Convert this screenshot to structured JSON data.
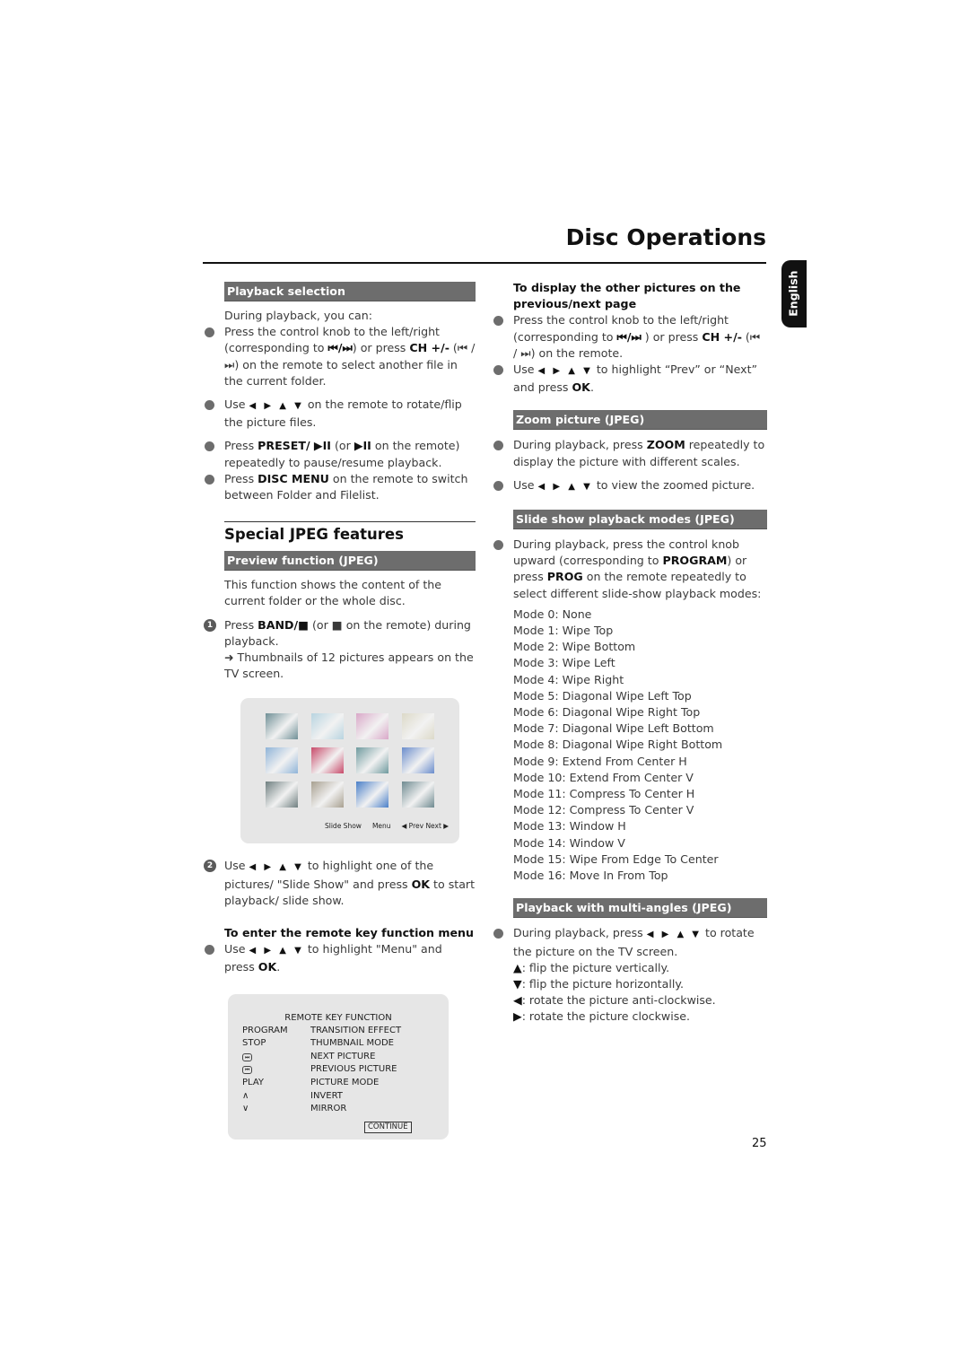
{
  "header": {
    "title": "Disc Operations",
    "language_tab": "English"
  },
  "left": {
    "playback_selection": {
      "heading": "Playback selection",
      "intro": "During playback, you can:",
      "items": [
        {
          "pre": "Press the control knob to the left/right (corresponding to ",
          "sym": "⏮/⏭",
          "mid": ") or press ",
          "bold": "CH +/-",
          "post": " (⏮ / ⏭) on the remote to select another file in the current folder."
        },
        {
          "pre": "Use ",
          "sym": "◀ ▶ ▲ ▼",
          "post": " on the remote to rotate/flip the picture files."
        },
        {
          "pre": "Press ",
          "bold": "PRESET/ ▶II",
          "mid": " (or ",
          "sym": "▶II",
          "post": " on the remote) repeatedly to pause/resume playback."
        },
        {
          "pre": "Press ",
          "bold": "DISC MENU",
          "post": " on the remote to switch between Folder and Filelist."
        }
      ]
    },
    "special": {
      "heading": "Special JPEG features",
      "preview_heading": "Preview function (JPEG)",
      "preview_intro": "This function shows the content of the current folder or the whole disc.",
      "step1": {
        "num": "1",
        "pre": "Press ",
        "bold": "BAND/■",
        "post": " (or ■ on the remote) during playback.",
        "result": "➜ Thumbnails of 12 pictures appears on the TV screen."
      },
      "thumbnail_screen": {
        "thumbnail_count": 12,
        "thumb_colors": [
          "#6f8f96",
          "#b8d4e0",
          "#d9a8c8",
          "#dcd9c8",
          "#8fb4d8",
          "#c84a6a",
          "#6f9a9e",
          "#6a8ccc",
          "#6f7f80",
          "#a8a090",
          "#4a7fc8",
          "#6f8a90"
        ],
        "nav": {
          "slide_show": "Slide Show",
          "menu": "Menu",
          "prev": "◀ Prev",
          "next": "Next ▶"
        }
      },
      "step2": {
        "num": "2",
        "pre": "Use ",
        "sym": "◀ ▶ ▲ ▼",
        "mid": " to highlight one of the pictures/ \"Slide Show\" and press ",
        "bold": "OK",
        "post": " to start playback/ slide show."
      },
      "remote_menu_heading": "To enter the remote key function menu",
      "remote_menu_item": {
        "pre": "Use ",
        "sym": "◀ ▶ ▲ ▼",
        "mid": " to highlight \"Menu\" and press ",
        "bold": "OK",
        "post": "."
      },
      "remote_screen": {
        "title": "REMOTE KEY FUNCTION",
        "rows": [
          {
            "key": "PROGRAM",
            "function": "TRANSITION EFFECT"
          },
          {
            "key": "STOP",
            "function": "THUMBNAIL MODE"
          },
          {
            "key": "⏭",
            "function": "NEXT PICTURE"
          },
          {
            "key": "⏮",
            "function": "PREVIOUS PICTURE"
          },
          {
            "key": "PLAY",
            "function": "PICTURE MODE"
          },
          {
            "key": "∧",
            "function": "INVERT"
          },
          {
            "key": "∨",
            "function": "MIRROR"
          }
        ],
        "continue_label": "CONTINUE"
      }
    }
  },
  "right": {
    "other_pictures": {
      "heading": "To display the other pictures on the previous/next page",
      "items": [
        {
          "pre": "Press the control knob to the left/right (corresponding to ",
          "sym": "⏮/⏭",
          "mid": " ) or press ",
          "bold": "CH +/-",
          "post": " (⏮ / ⏭) on the remote."
        },
        {
          "pre": "Use ",
          "sym": "◀ ▶ ▲ ▼",
          "mid": " to highlight “Prev” or “Next” and press ",
          "bold": "OK",
          "post": "."
        }
      ]
    },
    "zoom": {
      "heading": "Zoom picture (JPEG)",
      "items": [
        {
          "pre": "During playback, press ",
          "bold": "ZOOM",
          "post": " repeatedly to display the picture with different scales."
        },
        {
          "pre": "Use ",
          "sym": "◀ ▶ ▲ ▼",
          "post": " to view the zoomed picture."
        }
      ]
    },
    "slideshow": {
      "heading": "Slide show playback modes (JPEG)",
      "item": {
        "pre": "During playback, press the control knob upward (corresponding to ",
        "bold": "PROGRAM",
        "mid": ") or press ",
        "bold2": "PROG",
        "post": " on the remote repeatedly to select different slide-show playback modes:"
      },
      "modes": [
        "Mode 0: None",
        "Mode 1: Wipe Top",
        "Mode 2: Wipe Bottom",
        "Mode 3: Wipe Left",
        "Mode 4: Wipe Right",
        "Mode 5: Diagonal Wipe Left Top",
        "Mode 6: Diagonal Wipe Right Top",
        "Mode 7: Diagonal Wipe Left Bottom",
        "Mode 8: Diagonal Wipe Right Bottom",
        "Mode 9: Extend From Center H",
        "Mode 10: Extend From Center V",
        "Mode 11: Compress To Center H",
        "Mode 12: Compress To Center V",
        "Mode 13: Window H",
        "Mode 14: Window V",
        "Mode 15: Wipe From Edge To Center",
        "Mode 16: Move In From Top"
      ]
    },
    "multiangle": {
      "heading": "Playback with multi-angles (JPEG)",
      "item": {
        "pre": "During playback, press ",
        "sym": "◀ ▶ ▲ ▼",
        "post": " to rotate the picture on the TV screen."
      },
      "actions": [
        {
          "sym": "▲",
          "text": ": flip the picture vertically."
        },
        {
          "sym": "▼",
          "text": ":  flip the picture horizontally."
        },
        {
          "sym": "◀",
          "text": ": rotate the picture anti-clockwise."
        },
        {
          "sym": "▶",
          "text": ": rotate the picture clockwise."
        }
      ]
    }
  },
  "footer": {
    "page_number": "25"
  }
}
